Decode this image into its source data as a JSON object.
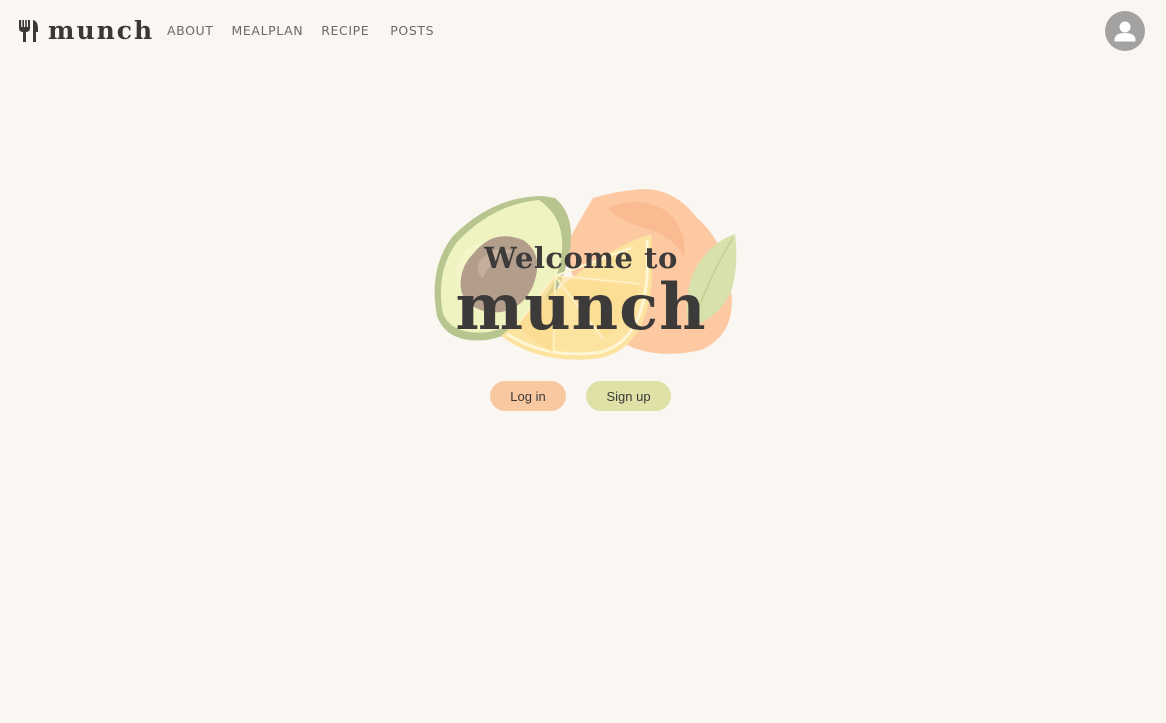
{
  "header": {
    "brand": "munch",
    "logo_icon": "fork-knife-icon",
    "nav": [
      {
        "label": "ABOUT"
      },
      {
        "label": "MEALPLAN"
      },
      {
        "label": "RECIPE"
      },
      {
        "label": "POSTS"
      }
    ],
    "avatar_icon": "user-avatar-icon"
  },
  "hero": {
    "welcome": "Welcome to",
    "brand": "munch",
    "illustration_icons": [
      "avocado-icon",
      "lemon-slice-icon",
      "orange-icon",
      "leaf-icon"
    ]
  },
  "actions": {
    "login_label": "Log in",
    "signup_label": "Sign up"
  },
  "colors": {
    "background": "#faf6f2",
    "login_button": "#f8c9a0",
    "signup_button": "#dfe1a7",
    "text": "#3d3b39",
    "avatar": "#a4a2a1"
  }
}
